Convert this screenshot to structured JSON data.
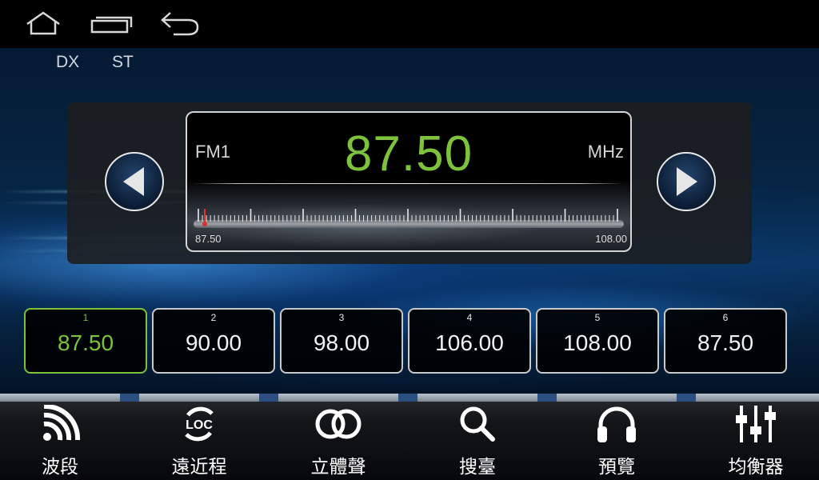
{
  "navbar": {
    "home_icon": "home-icon",
    "recents_icon": "recent-apps-icon",
    "back_icon": "back-icon"
  },
  "indicators": {
    "dx": "DX",
    "st": "ST"
  },
  "tuner": {
    "band": "FM1",
    "frequency": "87.50",
    "unit": "MHz",
    "scale_min": "87.50",
    "scale_max": "108.00",
    "needle_position": 0.0
  },
  "presets": [
    {
      "number": "1",
      "value": "87.50",
      "active": true
    },
    {
      "number": "2",
      "value": "90.00"
    },
    {
      "number": "3",
      "value": "98.00"
    },
    {
      "number": "4",
      "value": "106.00"
    },
    {
      "number": "5",
      "value": "108.00"
    },
    {
      "number": "6",
      "value": "87.50"
    }
  ],
  "toolbar": [
    {
      "label": "波段",
      "icon": "band-signal-icon"
    },
    {
      "label": "遠近程",
      "icon": "loc-icon",
      "icon_text": "LOC"
    },
    {
      "label": "立體聲",
      "icon": "stereo-icon"
    },
    {
      "label": "搜臺",
      "icon": "search-icon"
    },
    {
      "label": "預覽",
      "icon": "headphones-icon"
    },
    {
      "label": "均衡器",
      "icon": "equalizer-icon"
    }
  ],
  "colors": {
    "accent": "#7cc23a",
    "background": "#04101f"
  }
}
